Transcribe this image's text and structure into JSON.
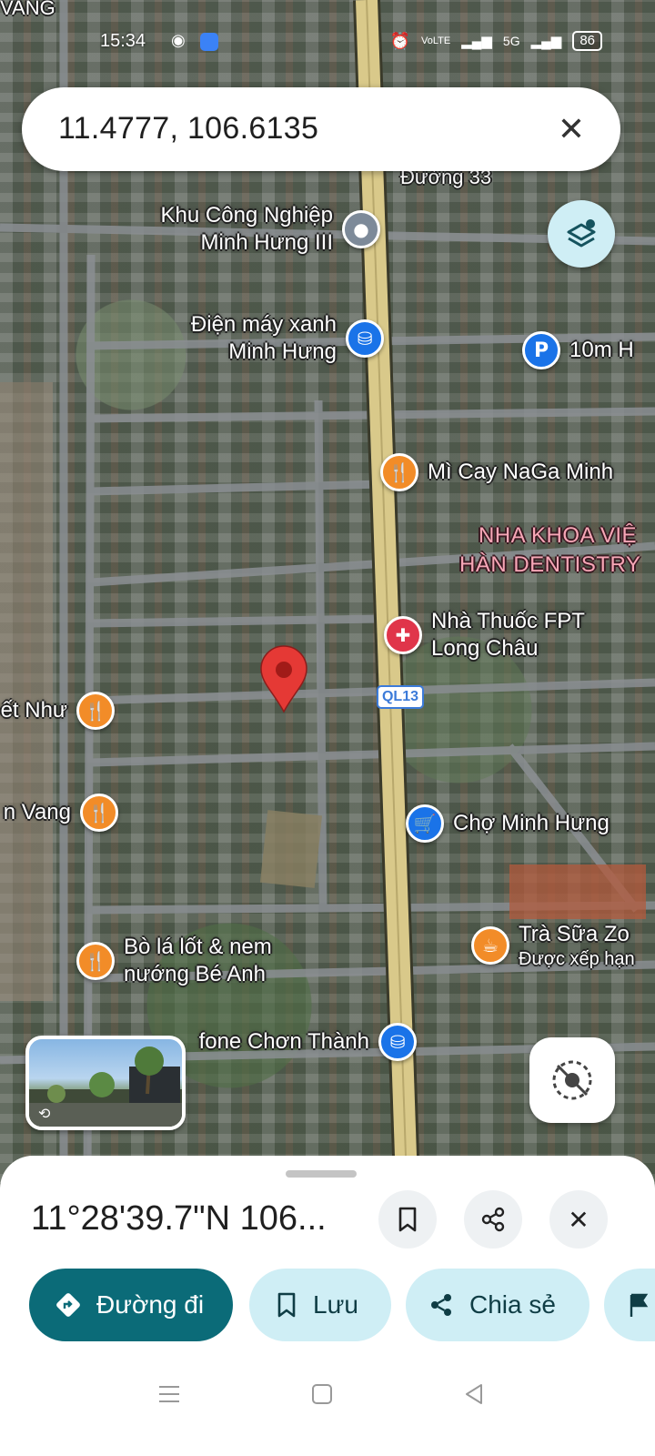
{
  "status_bar": {
    "time": "15:34",
    "network": "5G",
    "battery": "86",
    "volte": "VoLTE"
  },
  "search": {
    "query": "11.4777, 106.6135",
    "close_icon": "close-icon"
  },
  "map": {
    "road_label": "QL13",
    "top_left_label": "VANG",
    "street_label": "Đường 33",
    "pois": {
      "khu_cong_nghiep": [
        "Khu Công Nghiệp",
        "Minh Hưng III"
      ],
      "dien_may_xanh": [
        "Điện máy xanh",
        "Minh Hưng"
      ],
      "parking": "10m H",
      "mi_cay": "Mì Cay NaGa Minh",
      "nha_khoa": [
        "NHA KHOA VIỆ",
        "HÀN DENTISTRY"
      ],
      "nha_thuoc": [
        "Nhà Thuốc FPT",
        "Long Châu"
      ],
      "left_food_1": "ết Như",
      "left_food_2": "n Vang",
      "cho": "Chợ Minh Hưng",
      "tra_sua": [
        "Trà Sữa Zo",
        "Được xếp hạn"
      ],
      "bo_la_lot": [
        "Bò lá lốt & nem",
        "nướng Bé Anh"
      ],
      "viettel": "fone Chơn Thành"
    },
    "colors": {
      "road": "#d9c98a",
      "food": "#f28c28",
      "shop": "#1a73e8",
      "pharmacy": "#e0354a",
      "pin": "#e53935"
    }
  },
  "sheet": {
    "coords": "11°28'39.7\"N 106...",
    "actions": {
      "directions": "Đường đi",
      "save": "Lưu",
      "share": "Chia sẻ"
    }
  }
}
